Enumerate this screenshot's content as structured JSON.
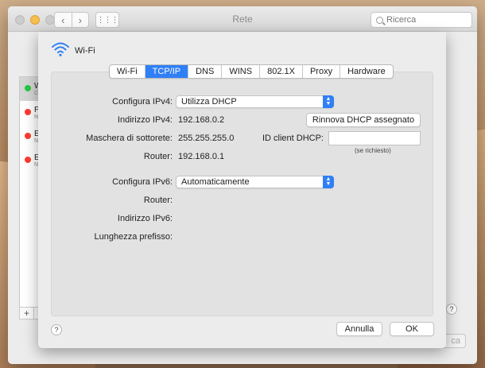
{
  "window": {
    "title": "Rete",
    "search_placeholder": "Ricerca",
    "nav_back": "‹",
    "nav_forward": "›",
    "grid_glyph": "⋮⋮⋮"
  },
  "sidebar": {
    "items": [
      {
        "label": "W",
        "sub": "C",
        "status_color": "#27c93f"
      },
      {
        "label": "P",
        "sub": "N",
        "status_color": "#ff3b30"
      },
      {
        "label": "E",
        "sub": "N",
        "status_color": "#ff3b30"
      },
      {
        "label": "E",
        "sub": "N",
        "status_color": "#ff3b30"
      }
    ],
    "add_label": "+",
    "remove_label": "−"
  },
  "background": {
    "help_label": "?",
    "partial_button": "ca"
  },
  "sheet": {
    "interface_name": "Wi-Fi",
    "tabs": [
      {
        "label": "Wi-Fi",
        "active": false
      },
      {
        "label": "TCP/IP",
        "active": true
      },
      {
        "label": "DNS",
        "active": false
      },
      {
        "label": "WINS",
        "active": false
      },
      {
        "label": "802.1X",
        "active": false
      },
      {
        "label": "Proxy",
        "active": false
      },
      {
        "label": "Hardware",
        "active": false
      }
    ],
    "ipv4": {
      "config_label": "Configura IPv4:",
      "config_value": "Utilizza DHCP",
      "address_label": "Indirizzo IPv4:",
      "address_value": "192.168.0.2",
      "renew_button": "Rinnova DHCP assegnato",
      "subnet_label": "Maschera di sottorete:",
      "subnet_value": "255.255.255.0",
      "client_id_label": "ID client DHCP:",
      "client_id_value": "",
      "client_id_hint": "(se richiesto)",
      "router_label": "Router:",
      "router_value": "192.168.0.1"
    },
    "ipv6": {
      "config_label": "Configura IPv6:",
      "config_value": "Automaticamente",
      "router_label": "Router:",
      "address_label": "Indirizzo IPv6:",
      "prefix_label": "Lunghezza prefisso:"
    },
    "help_label": "?",
    "cancel_button": "Annulla",
    "ok_button": "OK"
  },
  "colors": {
    "accent": "#2f7ff6",
    "status_green": "#27c93f",
    "status_red": "#ff3b30"
  }
}
